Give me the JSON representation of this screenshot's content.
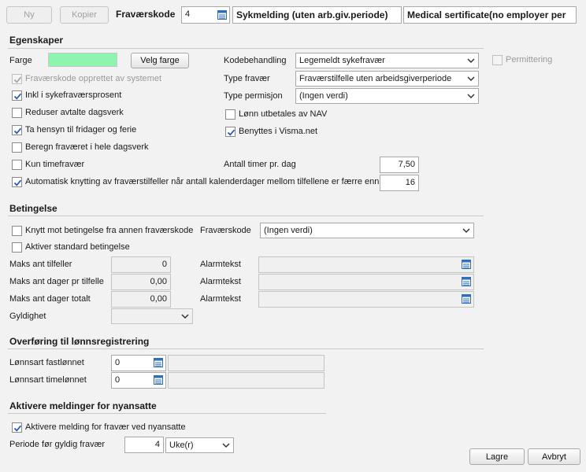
{
  "toolbar": {
    "new_label": "Ny",
    "copy_label": "Kopier",
    "code_label": "Fraværskode",
    "code_value": "4",
    "name_value": "Sykmelding (uten arb.giv.periode)",
    "name_en_value": "Medical sertificate(no employer per"
  },
  "properties": {
    "title": "Egenskaper",
    "color_label": "Farge",
    "color_value": "#8ef5b0",
    "choose_color_label": "Velg farge",
    "system_created_label": "Fraværskode opprettet av systemet",
    "include_sick_label": "Inkl i sykefraværsprosent",
    "reduce_workdays_label": "Reduser avtalte dagsverk",
    "holidays_label": "Ta hensyn til fridager og ferie",
    "whole_days_label": "Beregn fraværet i hele dagsverk",
    "hours_only_label": "Kun timefravær",
    "auto_link_label": "Automatisk knytting av fraværstilfeller når antall kalenderdager mellom tilfellene er færre enn",
    "auto_link_value": "16",
    "code_handling_label": "Kodebehandling",
    "code_handling_value": "Legemeldt sykefravær",
    "absence_type_label": "Type fravær",
    "absence_type_value": "Fraværstilfelle uten arbeidsgiverperiode",
    "leave_type_label": "Type permisjon",
    "leave_type_value": "(Ingen verdi)",
    "nav_pay_label": "Lønn utbetales av NAV",
    "visma_label": "Benyttes i Visma.net",
    "hours_per_day_label": "Antall timer pr. dag",
    "hours_per_day_value": "7,50",
    "layoff_label": "Permittering"
  },
  "conditions": {
    "title": "Betingelse",
    "link_other_label": "Knytt mot betingelse fra annen fraværskode",
    "code_label": "Fraværskode",
    "code_value": "(Ingen verdi)",
    "activate_std_label": "Aktiver standard betingelse",
    "max_cases_label": "Maks ant tilfeller",
    "max_cases_value": "0",
    "max_days_case_label": "Maks ant dager pr tilfelle",
    "max_days_case_value": "0,00",
    "max_days_total_label": "Maks ant dager totalt",
    "max_days_total_value": "0,00",
    "alarm_label": "Alarmtekst",
    "validity_label": "Gyldighet"
  },
  "transfer": {
    "title": "Overføring til lønnsregistrering",
    "fixed_label": "Lønnsart fastlønnet",
    "fixed_value": "0",
    "hourly_label": "Lønnsart timelønnet",
    "hourly_value": "0"
  },
  "notify": {
    "title": "Aktivere meldinger for nyansatte",
    "activate_label": "Aktivere melding for fravær ved nyansatte",
    "period_label": "Periode før gyldig fravær",
    "period_value": "4",
    "unit_value": "Uke(r)"
  },
  "footer": {
    "save_label": "Lagre",
    "cancel_label": "Avbryt"
  }
}
